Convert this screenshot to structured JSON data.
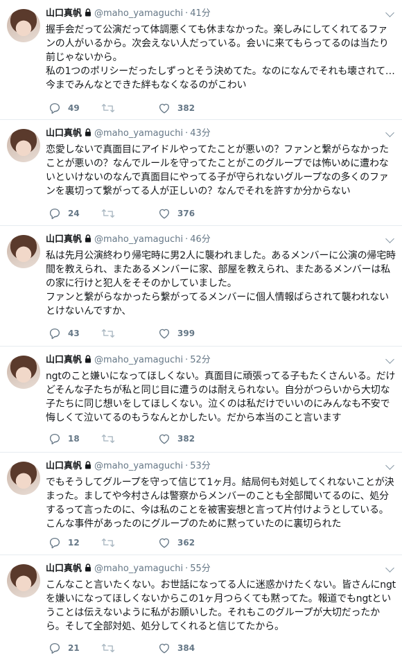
{
  "tweets": [
    {
      "name": "山口真帆",
      "handle": "@maho_yamaguchi",
      "time": "41分",
      "text": "握手会だって公演だって体調悪くても休まなかった。楽しみにしてくれてるファンの人がいるから。次会えない人だっている。会いに来てもらってるのは当たり前じゃないから。\n私の1つのポリシーだったしずっとそう決めてた。なのになんでそれも壊されて…今までみんなとできた絆もなくなるのがこわい",
      "replies": "49",
      "retweets": "",
      "likes": "382"
    },
    {
      "name": "山口真帆",
      "handle": "@maho_yamaguchi",
      "time": "43分",
      "text": "恋愛しないで真面目にアイドルやってたことが悪いの？ファンと繋がらなかったことが悪いの？なんでルールを守ってたことがこのグループでは怖いめに遭わないといけないのなんで真面目にやってる子が守られないグループなの多くのファンを裏切って繋がってる人が正しいの？なんでそれを許すか分からない",
      "replies": "24",
      "retweets": "",
      "likes": "376"
    },
    {
      "name": "山口真帆",
      "handle": "@maho_yamaguchi",
      "time": "46分",
      "text": "私は先月公演終わり帰宅時に男2人に襲われました。あるメンバーに公演の帰宅時間を教えられ、またあるメンバーに家、部屋を教えられ、またあるメンバーは私の家に行けと犯人をそそのかしていました。\nファンと繋がらなかったら繋がってるメンバーに個人情報ばらされて襲われないとけないんですか、",
      "replies": "43",
      "retweets": "",
      "likes": "399"
    },
    {
      "name": "山口真帆",
      "handle": "@maho_yamaguchi",
      "time": "52分",
      "text": "ngtのこと嫌いになってほしくない。真面目に頑張ってる子もたくさんいる。だけどそんな子たちが私と同じ目に遭うのは耐えられない。自分がつらいから大切な子たちに同じ想いをしてほしくない。泣くのは私だけでいいのにみんなも不安で悔しくて泣いてるのもうなんとかしたい。だから本当のこと言います",
      "replies": "18",
      "retweets": "",
      "likes": "382"
    },
    {
      "name": "山口真帆",
      "handle": "@maho_yamaguchi",
      "time": "53分",
      "text": "でもそうしてグループを守って信じて1ヶ月。結局何も対処してくれないことが決まった。ましてや今村さんは警察からメンバーのことも全部聞いてるのに、処分するって言ったのに、今は私のことを被害妄想と言って片付けようとしている。こんな事件があったのにグループのために黙っていたのに裏切られた",
      "replies": "12",
      "retweets": "",
      "likes": "362"
    },
    {
      "name": "山口真帆",
      "handle": "@maho_yamaguchi",
      "time": "55分",
      "text": "こんなこと言いたくない。お世話になってる人に迷惑かけたくない。皆さんにngtを嫌いになってほしくないからこの1ヶ月つらくても黙ってた。報道でもngtということは伝えないように私がお願いした。それもこのグループが大切だったから。そして全部対処、処分してくれると信じてたから。",
      "replies": "21",
      "retweets": "",
      "likes": "384"
    }
  ]
}
